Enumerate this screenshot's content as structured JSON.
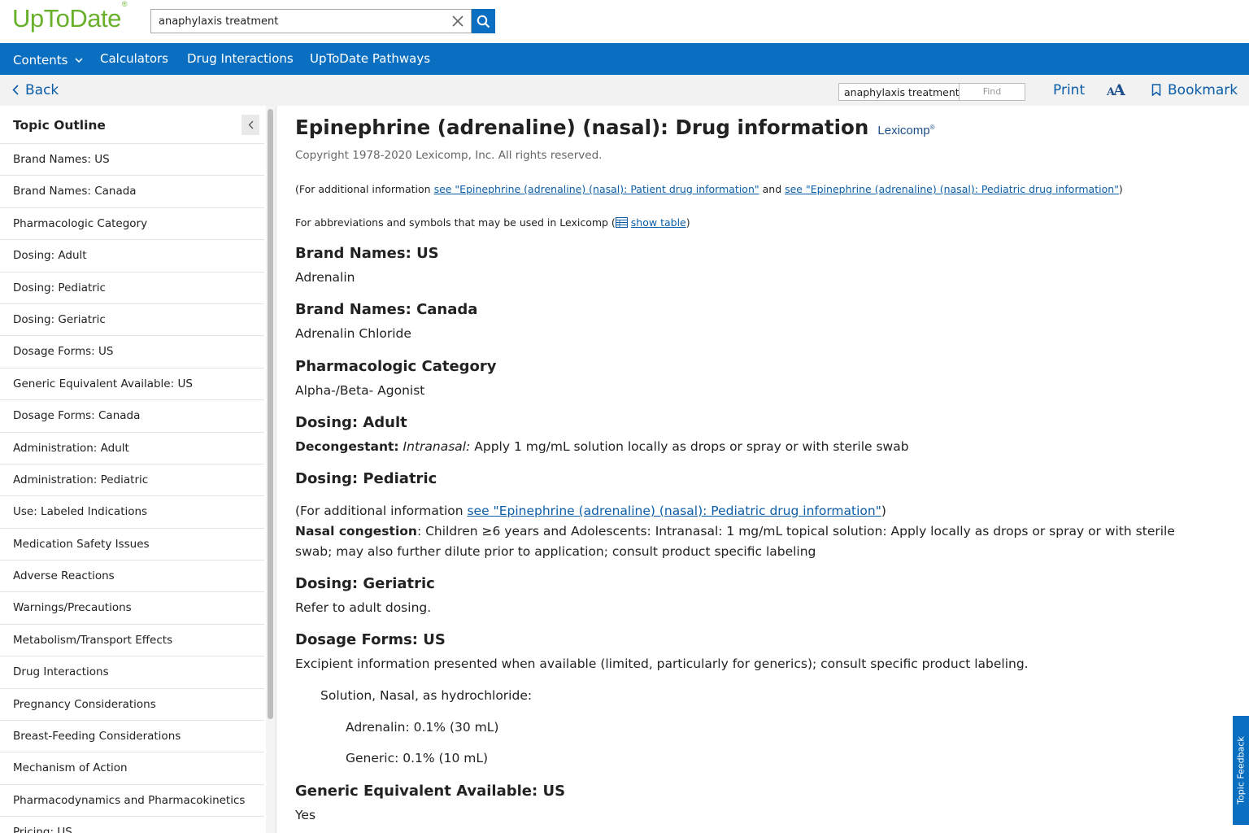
{
  "header": {
    "logo": "UpToDate",
    "logo_mark": "®",
    "search_value": "anaphylaxis treatment"
  },
  "nav": {
    "items": [
      "Contents",
      "Calculators",
      "Drug Interactions",
      "UpToDate Pathways"
    ]
  },
  "toolbar": {
    "back": "Back",
    "find_value": "anaphylaxis treatment",
    "find_placeholder": "Find",
    "print": "Print",
    "font_size_small": "A",
    "font_size_big": "A",
    "bookmark": "Bookmark"
  },
  "sidebar": {
    "title": "Topic Outline",
    "items": [
      "Brand Names: US",
      "Brand Names: Canada",
      "Pharmacologic Category",
      "Dosing: Adult",
      "Dosing: Pediatric",
      "Dosing: Geriatric",
      "Dosage Forms: US",
      "Generic Equivalent Available: US",
      "Dosage Forms: Canada",
      "Administration: Adult",
      "Administration: Pediatric",
      "Use: Labeled Indications",
      "Medication Safety Issues",
      "Adverse Reactions",
      "Warnings/Precautions",
      "Metabolism/Transport Effects",
      "Drug Interactions",
      "Pregnancy Considerations",
      "Breast-Feeding Considerations",
      "Mechanism of Action",
      "Pharmacodynamics and Pharmacokinetics",
      "Pricing: US"
    ]
  },
  "content": {
    "title": "Epinephrine (adrenaline) (nasal): Drug information",
    "lexicomp": "Lexicomp",
    "lexicomp_mark": "®",
    "copyright": "Copyright 1978-2020 Lexicomp, Inc. All rights reserved.",
    "additional_prefix": "(For additional information ",
    "patient_link": "see \"Epinephrine (adrenaline) (nasal): Patient drug information\"",
    "and_text": " and ",
    "pediatric_link": "see \"Epinephrine (adrenaline) (nasal): Pediatric drug information\"",
    "close_paren": ")",
    "abbrev_prefix": "For abbreviations and symbols that may be used in Lexicomp (",
    "show_table": "show table",
    "brand_us_h": "Brand Names: US",
    "brand_us_p": "Adrenalin",
    "brand_ca_h": "Brand Names: Canada",
    "brand_ca_p": "Adrenalin Chloride",
    "pharm_h": "Pharmacologic Category",
    "pharm_p": "Alpha-/Beta- Agonist",
    "adult_h": "Dosing: Adult",
    "adult_label": "Decongestant:",
    "adult_route": "Intranasal:",
    "adult_text": " Apply 1 mg/mL solution locally as drops or spray or with sterile swab",
    "ped_h": "Dosing: Pediatric",
    "ped_prefix": "(For additional information ",
    "ped_link": "see \"Epinephrine (adrenaline) (nasal): Pediatric drug information\"",
    "ped_close": ")",
    "ped_label": "Nasal congestion",
    "ped_text": ": Children ≥6 years and Adolescents: Intranasal: 1 mg/mL topical solution: Apply locally as drops or spray or with sterile swab; may also further dilute prior to application; consult product specific labeling",
    "geri_h": "Dosing: Geriatric",
    "geri_p": "Refer to adult dosing.",
    "forms_h": "Dosage Forms: US",
    "forms_p": "Excipient information presented when available (limited, particularly for generics); consult specific product labeling.",
    "forms_sub": "Solution, Nasal, as hydrochloride:",
    "forms_item1": "Adrenalin: 0.1% (30 mL)",
    "forms_item2": "Generic: 0.1% (10 mL)",
    "generic_h": "Generic Equivalent Available: US",
    "generic_p": "Yes"
  },
  "feedback": "Topic Feedback",
  "colors": {
    "brand_green": "#69b02b",
    "nav_blue": "#0b6fc1",
    "link_blue": "#0b5da8"
  }
}
